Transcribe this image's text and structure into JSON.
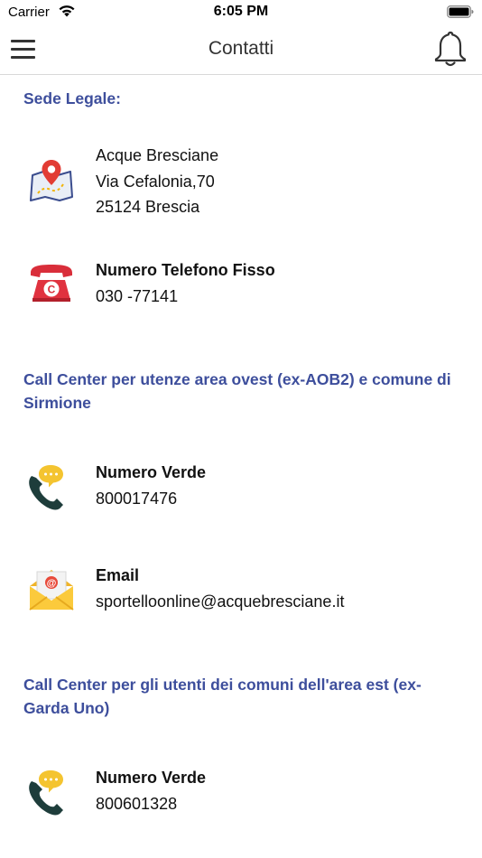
{
  "status_bar": {
    "carrier": "Carrier",
    "time": "6:05 PM"
  },
  "nav": {
    "title": "Contatti",
    "menu_icon": "hamburger-icon",
    "bell_icon": "bell-icon"
  },
  "sections": {
    "sede_legale": {
      "title": "Sede Legale:",
      "address": {
        "icon": "map-pin-icon",
        "line1": "Acque Bresciane",
        "line2": "Via Cefalonia,70",
        "line3": "25124 Brescia"
      },
      "phone": {
        "icon": "telephone-icon",
        "label": "Numero Telefono Fisso",
        "value": "030 -77141"
      }
    },
    "call_center_ovest": {
      "title": "Call Center per utenze area ovest (ex-AOB2) e comune di Sirmione",
      "verde": {
        "icon": "phone-chat-icon",
        "label": "Numero Verde",
        "value": "800017476"
      },
      "email": {
        "icon": "email-icon",
        "label": "Email",
        "value": "sportelloonline@acquebresciane.it"
      }
    },
    "call_center_est": {
      "title": "Call Center per gli utenti dei comuni dell'area est (ex-Garda Uno)",
      "verde": {
        "icon": "phone-chat-icon",
        "label": "Numero Verde",
        "value": "800601328"
      }
    }
  },
  "colors": {
    "section_title": "#3d4e9c",
    "nav_title": "#333333"
  }
}
